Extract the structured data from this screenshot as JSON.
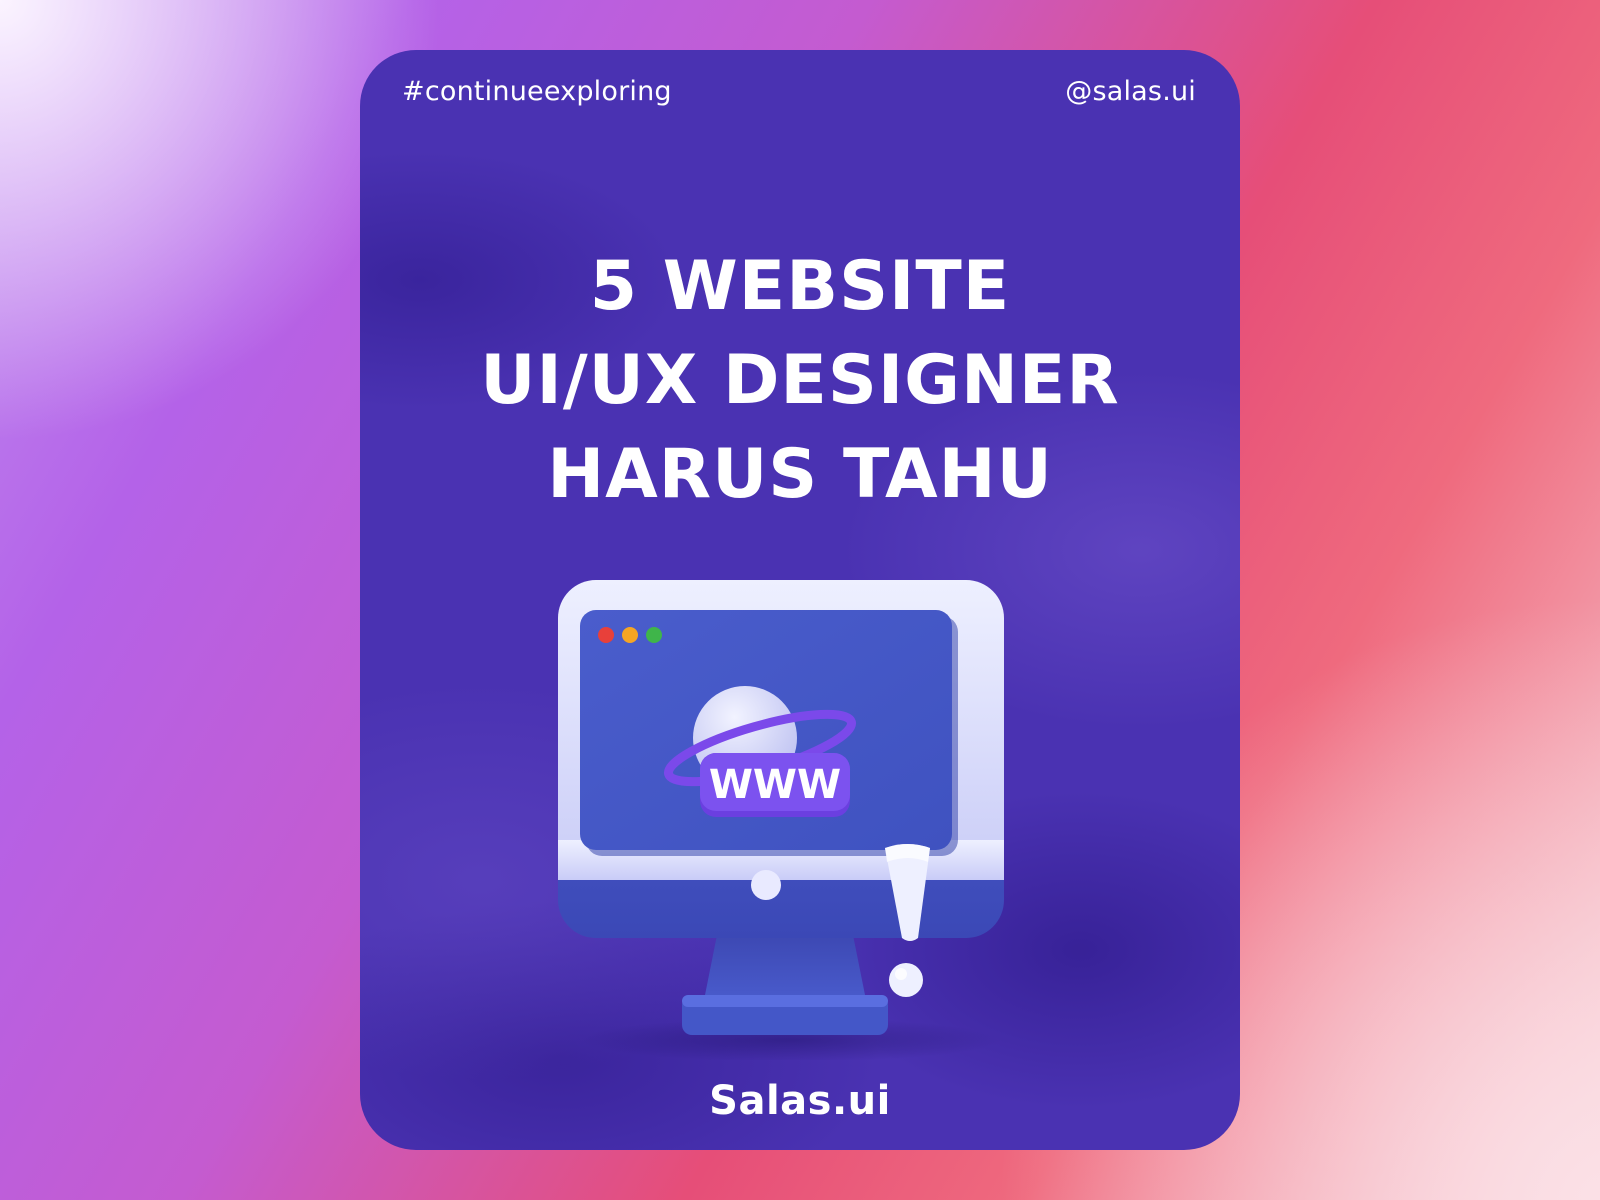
{
  "card": {
    "hashtag": "#continueexploring",
    "handle": "@salas.ui",
    "headline": {
      "line1": "5 WEBSITE",
      "line2": "UI/UX DESIGNER",
      "line3": "HARUS TAHU"
    },
    "illustration": {
      "screen_text": "WWW",
      "icons": [
        "monitor-icon",
        "globe-icon",
        "exclamation-icon"
      ]
    },
    "brand": "Salas.ui"
  },
  "colors": {
    "card_background": "#4a32b2",
    "text": "#ffffff",
    "screen": "#4558c8",
    "monitor_frame": "#dfe0ff",
    "monitor_base": "#4a5cc8",
    "badge": "#6b3fe0",
    "dot_red": "#e8403a",
    "dot_yellow": "#f5a524",
    "dot_green": "#3fb54a"
  }
}
